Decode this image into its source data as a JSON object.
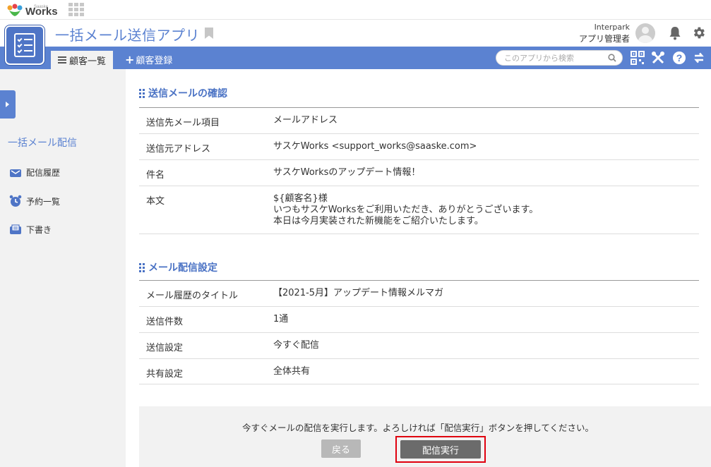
{
  "brand": {
    "name": "Works",
    "sup": "Saaske"
  },
  "app": {
    "title": "一括メール送信アプリ"
  },
  "user": {
    "org": "Interpark",
    "role": "アプリ管理者"
  },
  "nav": {
    "tab_list": "顧客一覧",
    "tab_register": "顧客登録",
    "search_placeholder": "このアプリから検索"
  },
  "sidebar": {
    "heading": "一括メール配信",
    "items": [
      {
        "label": "配信履歴",
        "icon": "mail-history-icon"
      },
      {
        "label": "予約一覧",
        "icon": "alarm-clock-icon"
      },
      {
        "label": "下書き",
        "icon": "draft-icon"
      }
    ]
  },
  "confirm": {
    "title": "送信メールの確認",
    "rows": [
      {
        "key": "送信先メール項目",
        "value": "メールアドレス"
      },
      {
        "key": "送信元アドレス",
        "value": "サスケWorks <support_works@saaske.com>"
      },
      {
        "key": "件名",
        "value": "サスケWorksのアップデート情報！"
      },
      {
        "key": "本文",
        "lines": [
          "${顧客名}様",
          "いつもサスケWorksをご利用いただき、ありがとうございます。",
          "本日は今月実装された新機能をご紹介いたします。"
        ]
      }
    ]
  },
  "settings": {
    "title": "メール配信設定",
    "rows": [
      {
        "key": "メール履歴のタイトル",
        "value": "【2021-5月】アップデート情報メルマガ"
      },
      {
        "key": "送信件数",
        "value": "1通"
      },
      {
        "key": "送信設定",
        "value": "今すぐ配信"
      },
      {
        "key": "共有設定",
        "value": "全体共有"
      }
    ]
  },
  "footer": {
    "message": "今すぐメールの配信を実行します。よろしければ「配信実行」ボタンを押してください。",
    "back_label": "戻る",
    "execute_label": "配信実行"
  },
  "colors": {
    "accent": "#5b82d1",
    "highlight": "#e0000f"
  }
}
